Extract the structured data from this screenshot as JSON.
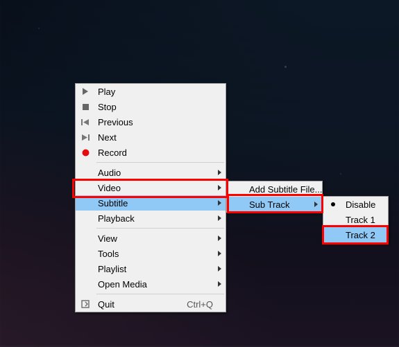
{
  "menu_main": {
    "play": "Play",
    "stop": "Stop",
    "previous": "Previous",
    "next": "Next",
    "record": "Record",
    "audio": "Audio",
    "video": "Video",
    "subtitle": "Subtitle",
    "playback": "Playback",
    "view": "View",
    "tools": "Tools",
    "playlist": "Playlist",
    "openmedia": "Open Media",
    "quit": "Quit",
    "quit_accel": "Ctrl+Q"
  },
  "menu_subtitle": {
    "add_file": "Add Subtitle File...",
    "sub_track": "Sub Track"
  },
  "menu_subtrack": {
    "disable": "Disable",
    "track1": "Track 1",
    "track2": "Track 2"
  },
  "highlighted": {
    "main": "subtitle",
    "sub": "sub_track",
    "leaf": "track2"
  }
}
